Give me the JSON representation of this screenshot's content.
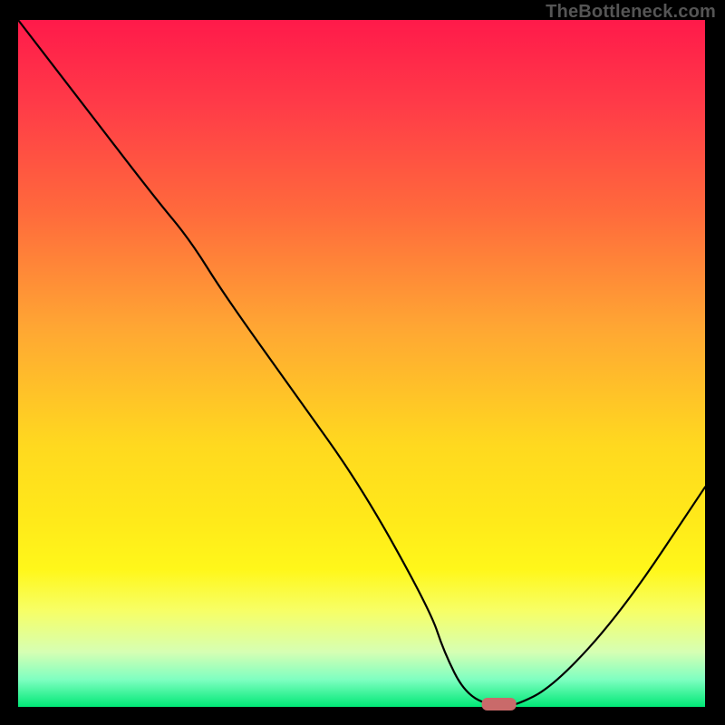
{
  "watermark": "TheBottleneck.com",
  "chart_data": {
    "type": "line",
    "title": "",
    "xlabel": "",
    "ylabel": "",
    "xlim": [
      0,
      100
    ],
    "ylim": [
      0,
      100
    ],
    "series": [
      {
        "name": "bottleneck-curve",
        "x": [
          0,
          10,
          20,
          25,
          30,
          40,
          50,
          60,
          62,
          65,
          69,
          72,
          78,
          88,
          100
        ],
        "y": [
          100,
          87,
          74,
          68,
          60,
          46,
          32,
          14,
          8,
          2,
          0,
          0,
          3,
          14,
          32
        ]
      }
    ],
    "marker": {
      "name": "optimal-point",
      "x": 70,
      "y": 0,
      "shape": "rounded-bar",
      "color": "#c96a6a"
    },
    "background_gradient": {
      "top": "#ff1a4a",
      "middle": "#ffd91f",
      "bottom": "#00e876"
    }
  }
}
